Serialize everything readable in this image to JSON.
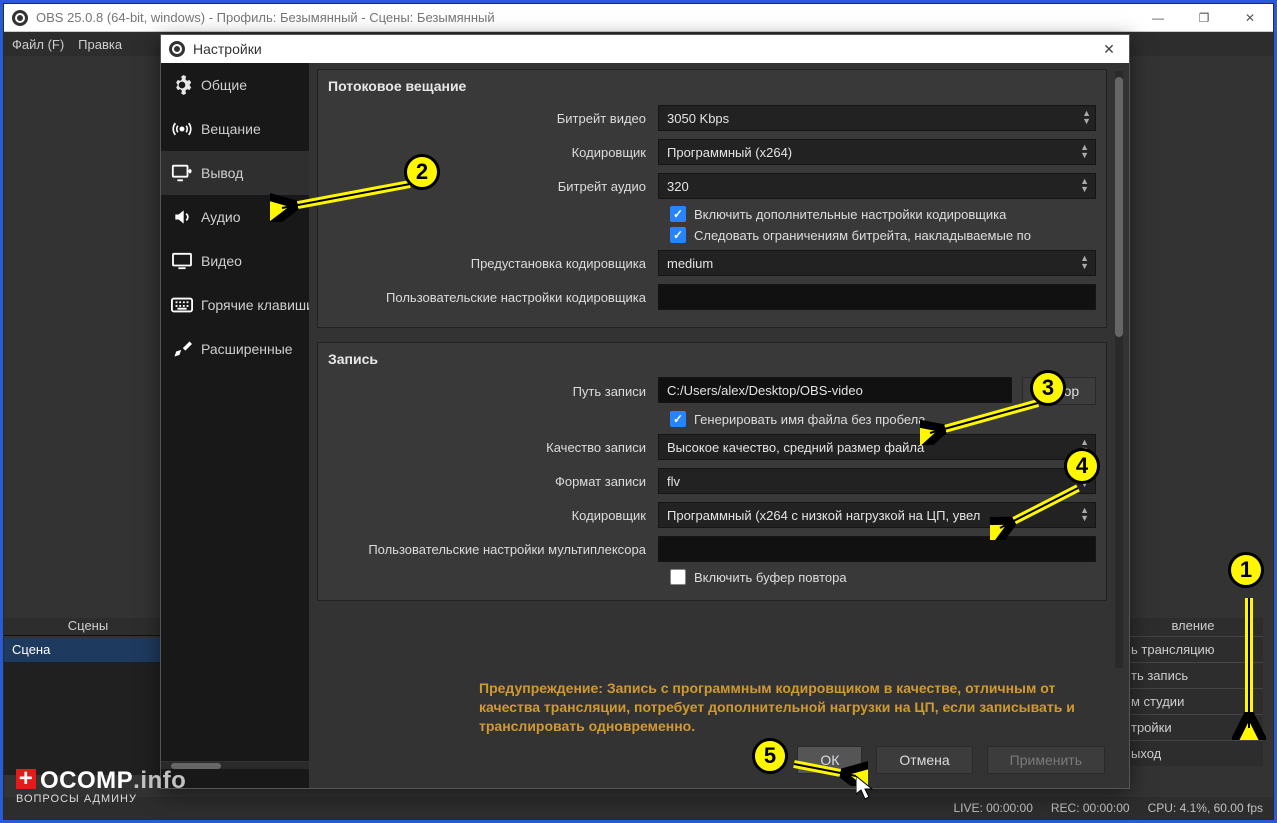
{
  "main_window": {
    "title": "OBS 25.0.8 (64-bit, windows) - Профиль: Безымянный - Сцены: Безымянный",
    "menu": {
      "file": "Файл (F)",
      "edit": "Правка"
    },
    "scenes_header": "Сцены",
    "scene_name": "Сцена",
    "right_panel": {
      "header": "вление",
      "btn_stream": "ь трансляцию",
      "btn_record": "ть запись",
      "btn_studio": "м студии",
      "btn_settings": "тройки",
      "btn_exit": "ыход"
    },
    "status": {
      "live": "LIVE: 00:00:00",
      "rec": "REC: 00:00:00",
      "cpu": "CPU: 4.1%, 60.00 fps"
    }
  },
  "settings_dialog": {
    "title": "Настройки",
    "sidebar": [
      {
        "icon": "gear-icon",
        "label": "Общие"
      },
      {
        "icon": "broadcast-icon",
        "label": "Вещание"
      },
      {
        "icon": "output-icon",
        "label": "Вывод",
        "selected": true
      },
      {
        "icon": "audio-icon",
        "label": "Аудио"
      },
      {
        "icon": "video-icon",
        "label": "Видео"
      },
      {
        "icon": "hotkeys-icon",
        "label": "Горячие клавиши"
      },
      {
        "icon": "advanced-icon",
        "label": "Расширенные"
      }
    ],
    "stream_section": {
      "heading": "Потоковое вещание",
      "video_bitrate_label": "Битрейт видео",
      "video_bitrate_value": "3050 Kbps",
      "encoder_label": "Кодировщик",
      "encoder_value": "Программный (x264)",
      "audio_bitrate_label": "Битрейт аудио",
      "audio_bitrate_value": "320",
      "cb_advanced": "Включить дополнительные настройки кодировщика",
      "cb_limit": "Следовать ограничениям битрейта, накладываемые по",
      "preset_label": "Предустановка кодировщика",
      "preset_value": "medium",
      "custom_label": "Пользовательские настройки кодировщика",
      "custom_value": ""
    },
    "record_section": {
      "heading": "Запись",
      "path_label": "Путь записи",
      "path_value": "C:/Users/alex/Desktop/OBS-video",
      "browse": "Обзор",
      "cb_nospace": "Генерировать имя файла без пробела",
      "quality_label": "Качество записи",
      "quality_value": "Высокое качество, средний размер файла",
      "format_label": "Формат записи",
      "format_value": "flv",
      "encoder_label": "Кодировщик",
      "encoder_value": "Программный (x264 с низкой нагрузкой на ЦП, увел",
      "mux_label": "Пользовательские настройки мультиплексора",
      "mux_value": "",
      "cb_replay": "Включить буфер повтора"
    },
    "warning": "Предупреждение: Запись с программным кодировщиком в качестве, отличным от качества трансляции, потребует дополнительной нагрузки на ЦП, если записывать и транслировать одновременно.",
    "buttons": {
      "ok": "ОК",
      "cancel": "Отмена",
      "apply": "Применить"
    }
  },
  "annotations": {
    "n1": "1",
    "n2": "2",
    "n3": "3",
    "n4": "4",
    "n5": "5"
  },
  "watermark": {
    "brand_o": "O",
    "brand_comp": "COMP",
    "brand_info": ".info",
    "subtitle": "ВОПРОСЫ АДМИНУ"
  }
}
